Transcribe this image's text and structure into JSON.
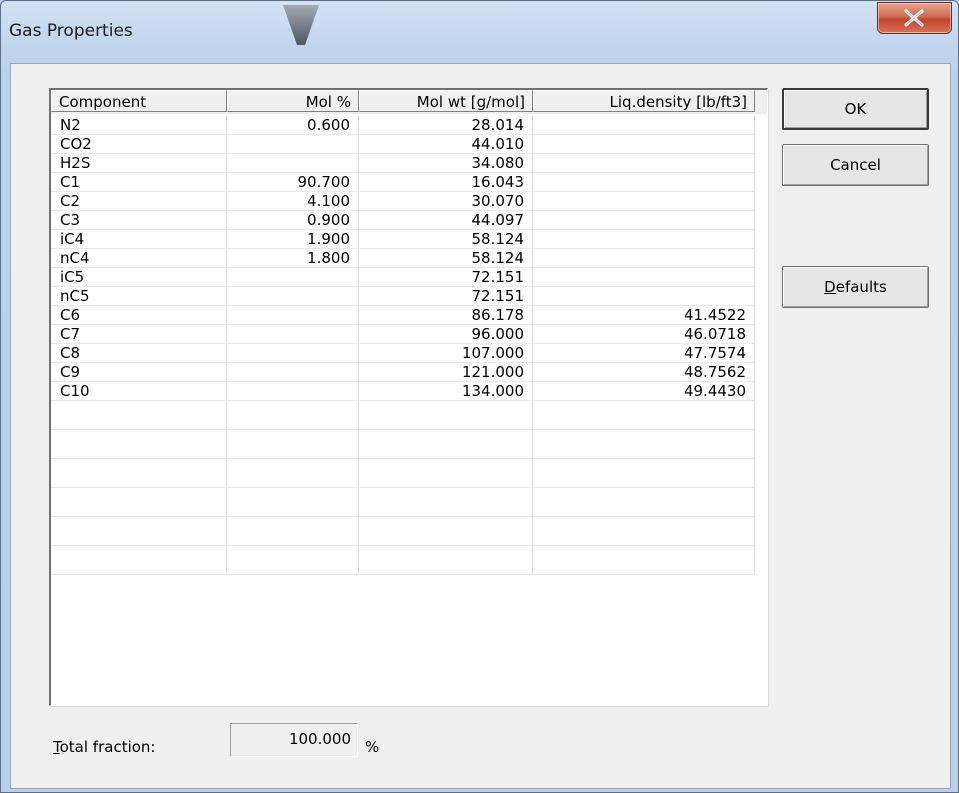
{
  "window": {
    "title": "Gas Properties"
  },
  "table": {
    "columns": [
      "Component",
      "Mol %",
      "Mol wt [g/mol]",
      "Liq.density [lb/ft3]"
    ],
    "rows": [
      [
        "N2",
        "0.600",
        "28.014",
        ""
      ],
      [
        "CO2",
        "",
        "44.010",
        ""
      ],
      [
        "H2S",
        "",
        "34.080",
        ""
      ],
      [
        "C1",
        "90.700",
        "16.043",
        ""
      ],
      [
        "C2",
        "4.100",
        "30.070",
        ""
      ],
      [
        "C3",
        "0.900",
        "44.097",
        ""
      ],
      [
        "iC4",
        "1.900",
        "58.124",
        ""
      ],
      [
        "nC4",
        "1.800",
        "58.124",
        ""
      ],
      [
        "iC5",
        "",
        "72.151",
        ""
      ],
      [
        "nC5",
        "",
        "72.151",
        ""
      ],
      [
        "C6",
        "",
        "86.178",
        "41.4522"
      ],
      [
        "C7",
        "",
        "96.000",
        "46.0718"
      ],
      [
        "C8",
        "",
        "107.000",
        "47.7574"
      ],
      [
        "C9",
        "",
        "121.000",
        "48.7562"
      ],
      [
        "C10",
        "",
        "134.000",
        "49.4430"
      ],
      [
        "",
        "",
        "",
        ""
      ],
      [
        "",
        "",
        "",
        ""
      ],
      [
        "",
        "",
        "",
        ""
      ],
      [
        "",
        "",
        "",
        ""
      ],
      [
        "",
        "",
        "",
        ""
      ],
      [
        "",
        "",
        "",
        ""
      ]
    ]
  },
  "buttons": {
    "ok": "OK",
    "cancel": "Cancel",
    "defaults_rest": "efaults",
    "defaults_mnemonic": "D"
  },
  "total": {
    "label_mnemonic": "T",
    "label_rest": "otal fraction:",
    "value": "100.000",
    "unit": "%"
  },
  "icons": {
    "close": "close-icon",
    "title_tab": "title-tab-icon"
  },
  "colors": {
    "close_button": "#c1432c",
    "title_bar": "#c3d7ee",
    "dialog_background": "#f0f0f0"
  }
}
